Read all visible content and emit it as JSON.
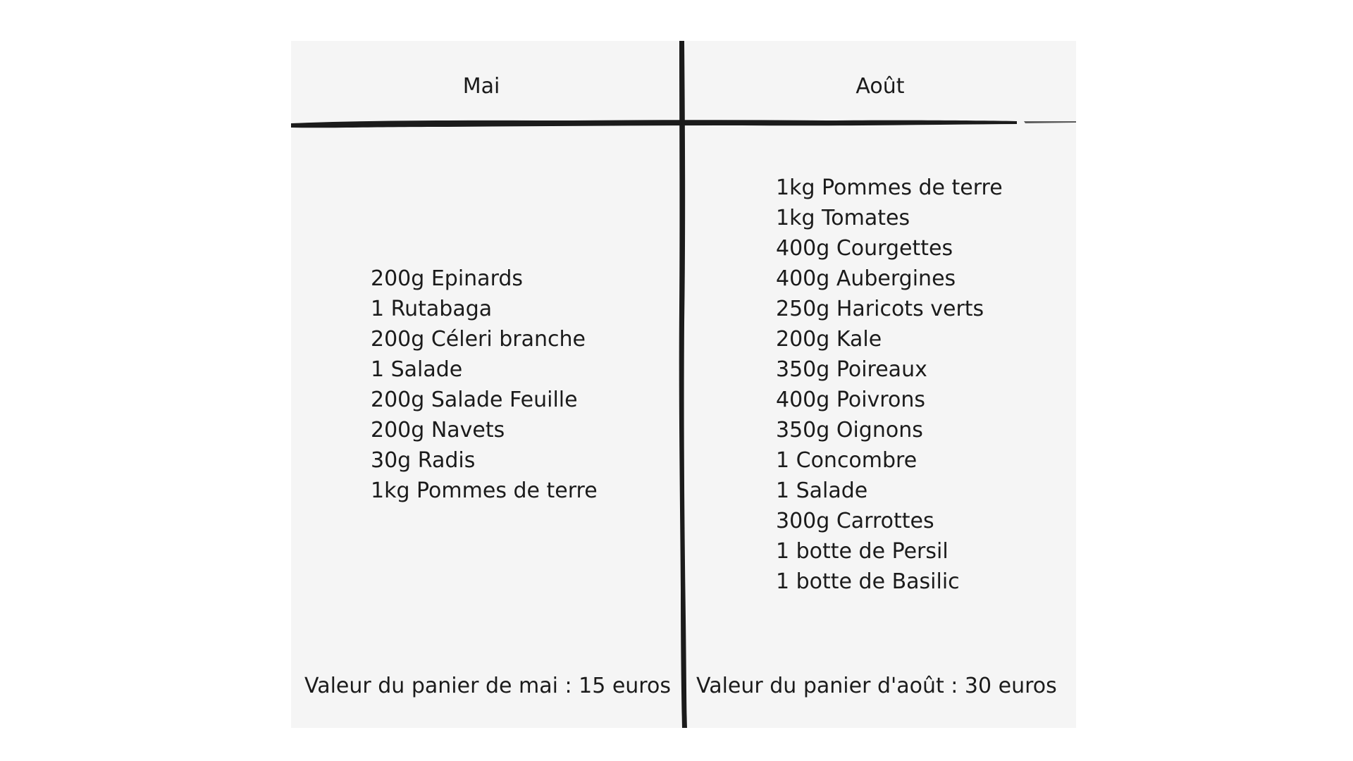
{
  "columns": {
    "left": {
      "header": "Mai",
      "items": [
        "200g Epinards",
        "1 Rutabaga",
        "200g Céleri branche",
        "1 Salade",
        "200g Salade Feuille",
        "200g Navets",
        "30g Radis",
        "1kg Pommes de terre"
      ],
      "total": "Valeur du panier de mai : 15 euros"
    },
    "right": {
      "header": "Août",
      "items": [
        "1kg Pommes de terre",
        "1kg Tomates",
        "400g Courgettes",
        "400g Aubergines",
        "250g Haricots verts",
        "200g Kale",
        "350g Poireaux",
        "400g Poivrons",
        "350g Oignons",
        "1 Concombre",
        "1 Salade",
        "300g Carrottes",
        "1 botte de Persil",
        "1 botte de Basilic"
      ],
      "total": "Valeur du panier d'août : 30 euros"
    }
  },
  "colors": {
    "background": "#ffffff",
    "board": "#f5f5f5",
    "ink": "#1b1b1b"
  }
}
